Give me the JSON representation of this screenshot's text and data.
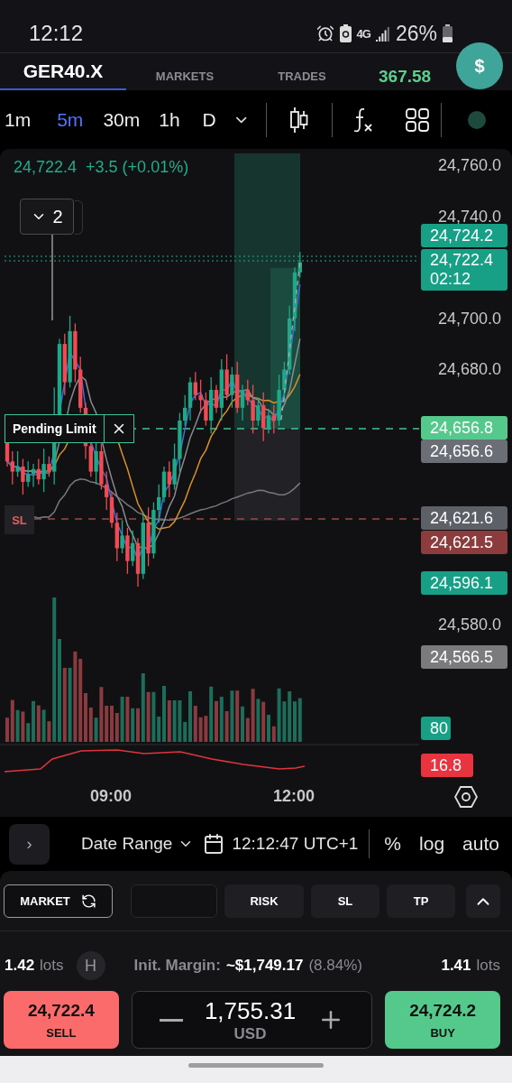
{
  "status_bar": {
    "time": "12:12",
    "network": "4G",
    "battery": "26%"
  },
  "header": {
    "items": [
      {
        "label": "GER40.X",
        "kind": "symbol",
        "selected": true
      },
      {
        "label": "MARKETS",
        "kind": "nav",
        "selected": false
      },
      {
        "label": "TRADES",
        "kind": "nav",
        "selected": false
      }
    ],
    "balance": "367.58",
    "account_button": "$"
  },
  "toolbar": {
    "timeframes": [
      {
        "label": "1m",
        "selected": false
      },
      {
        "label": "5m",
        "selected": true
      },
      {
        "label": "30m",
        "selected": false
      },
      {
        "label": "1h",
        "selected": false
      },
      {
        "label": "D",
        "selected": false
      }
    ]
  },
  "chart": {
    "last_price": "24,722.4",
    "change": "+3.5 (+0.01%)",
    "marker_count": "2",
    "order_label": "Pending Limit",
    "sl_label": "SL",
    "axis_labels": [
      "24,760.0",
      "24,740.0",
      "24,700.0",
      "24,680.0",
      "24,580.0"
    ],
    "price_tags": [
      {
        "text": "24,724.2",
        "color": "#17a085"
      },
      {
        "text": "24,722.4",
        "sub": "02:12",
        "color": "#17a085"
      },
      {
        "text": "24,656.8",
        "color": "#55c98c"
      },
      {
        "text": "24,656.6",
        "color": "#6c6e75"
      },
      {
        "text": "24,621.6",
        "color": "#5e6067"
      },
      {
        "text": "24,621.5",
        "color": "#8c3c3c"
      },
      {
        "text": "24,596.1",
        "color": "#17a085"
      },
      {
        "text": "24,566.5",
        "color": "#7b7b7d"
      },
      {
        "text": "80",
        "color": "#17a085"
      },
      {
        "text": "16.8",
        "color": "#e8343f"
      }
    ],
    "time_labels": [
      "09:00",
      "12:00"
    ]
  },
  "chart_footer": {
    "expand_glyph": "›",
    "date_range": "Date Range",
    "clock": "12:12:47 UTC+1",
    "options": [
      "%",
      "log",
      "auto"
    ]
  },
  "order_panel": {
    "order_type": "MARKET",
    "tabs": [
      "RISK",
      "SL",
      "TP"
    ],
    "sell_lots": "1.42",
    "sell_unit": "lots",
    "hedge": "H",
    "margin_label": "Init. Margin:",
    "margin_value": "~$1,749.17",
    "margin_pct": "(8.84%)",
    "buy_lots": "1.41",
    "buy_unit": "lots",
    "sell": {
      "price": "24,722.4",
      "label": "SELL"
    },
    "amount": "1,755.31",
    "currency": "USD",
    "buy": {
      "price": "24,724.2",
      "label": "BUY"
    }
  }
}
